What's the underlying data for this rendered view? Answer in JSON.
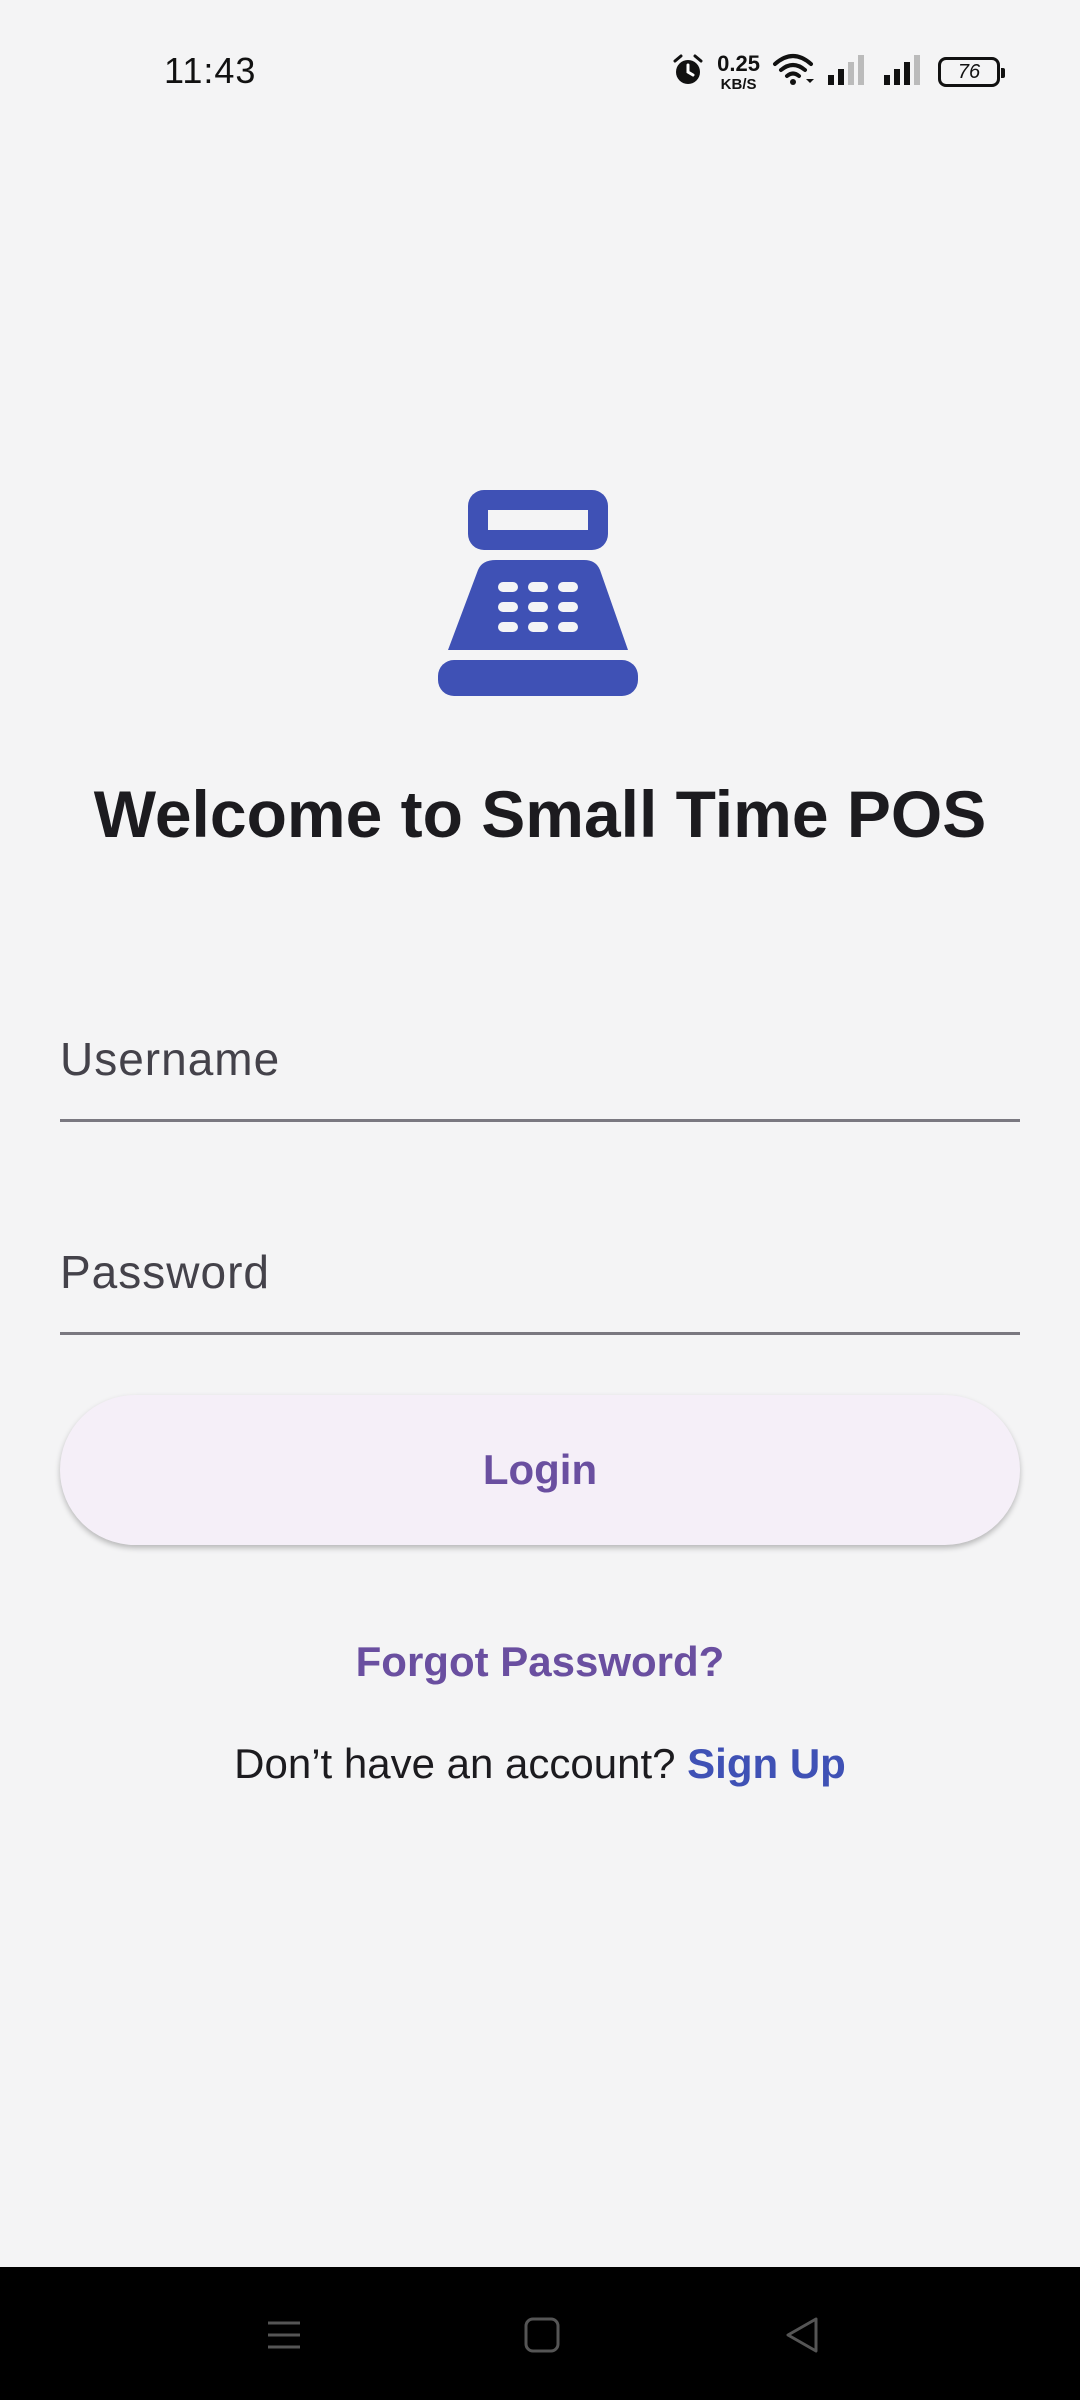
{
  "status_bar": {
    "time": "11:43",
    "net_speed_value": "0.25",
    "net_speed_unit": "KB/S",
    "battery": "76",
    "icons": [
      "alarm-icon",
      "wifi-icon",
      "signal-icon",
      "signal-icon",
      "battery-icon"
    ]
  },
  "logo": {
    "icon": "cash-register-icon",
    "color": "#3f51b5"
  },
  "welcome_title": "Welcome to Small Time POS",
  "form": {
    "username_label": "Username",
    "password_label": "Password",
    "login_label": "Login"
  },
  "links": {
    "forgot_password": "Forgot Password?",
    "no_account": "Don’t have an account?",
    "sign_up": "Sign Up"
  },
  "colors": {
    "primary": "#3f51b5",
    "accent_purple": "#6a4fa0",
    "button_bg": "#f5eff8",
    "background": "#f4f4f5"
  },
  "nav_bar": {
    "icons": [
      "menu-icon",
      "home-icon",
      "back-icon"
    ]
  }
}
